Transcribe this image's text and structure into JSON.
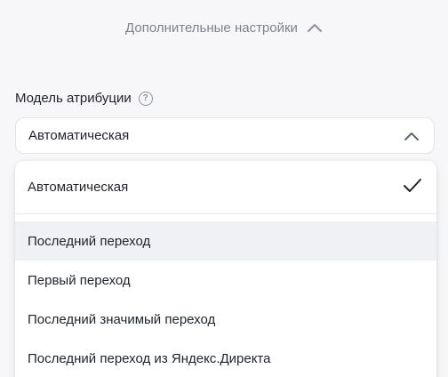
{
  "advanced": {
    "label": "Дополнительные настройки",
    "icon": "chevron-up-icon"
  },
  "attribution": {
    "label": "Модель атрибуции",
    "help_icon": "question-circle-icon",
    "help_glyph": "?",
    "selected_value": "Автоматическая",
    "options": [
      {
        "label": "Автоматическая",
        "selected": true
      },
      {
        "label": "Последний переход",
        "hovered": true
      },
      {
        "label": "Первый переход"
      },
      {
        "label": "Последний значимый переход"
      },
      {
        "label": "Последний переход из Яндекс.Директа"
      }
    ]
  },
  "colors": {
    "background": "#f7f7f9",
    "muted_text": "#7b8391",
    "text": "#1f2329",
    "hover": "#f0f1f4"
  }
}
